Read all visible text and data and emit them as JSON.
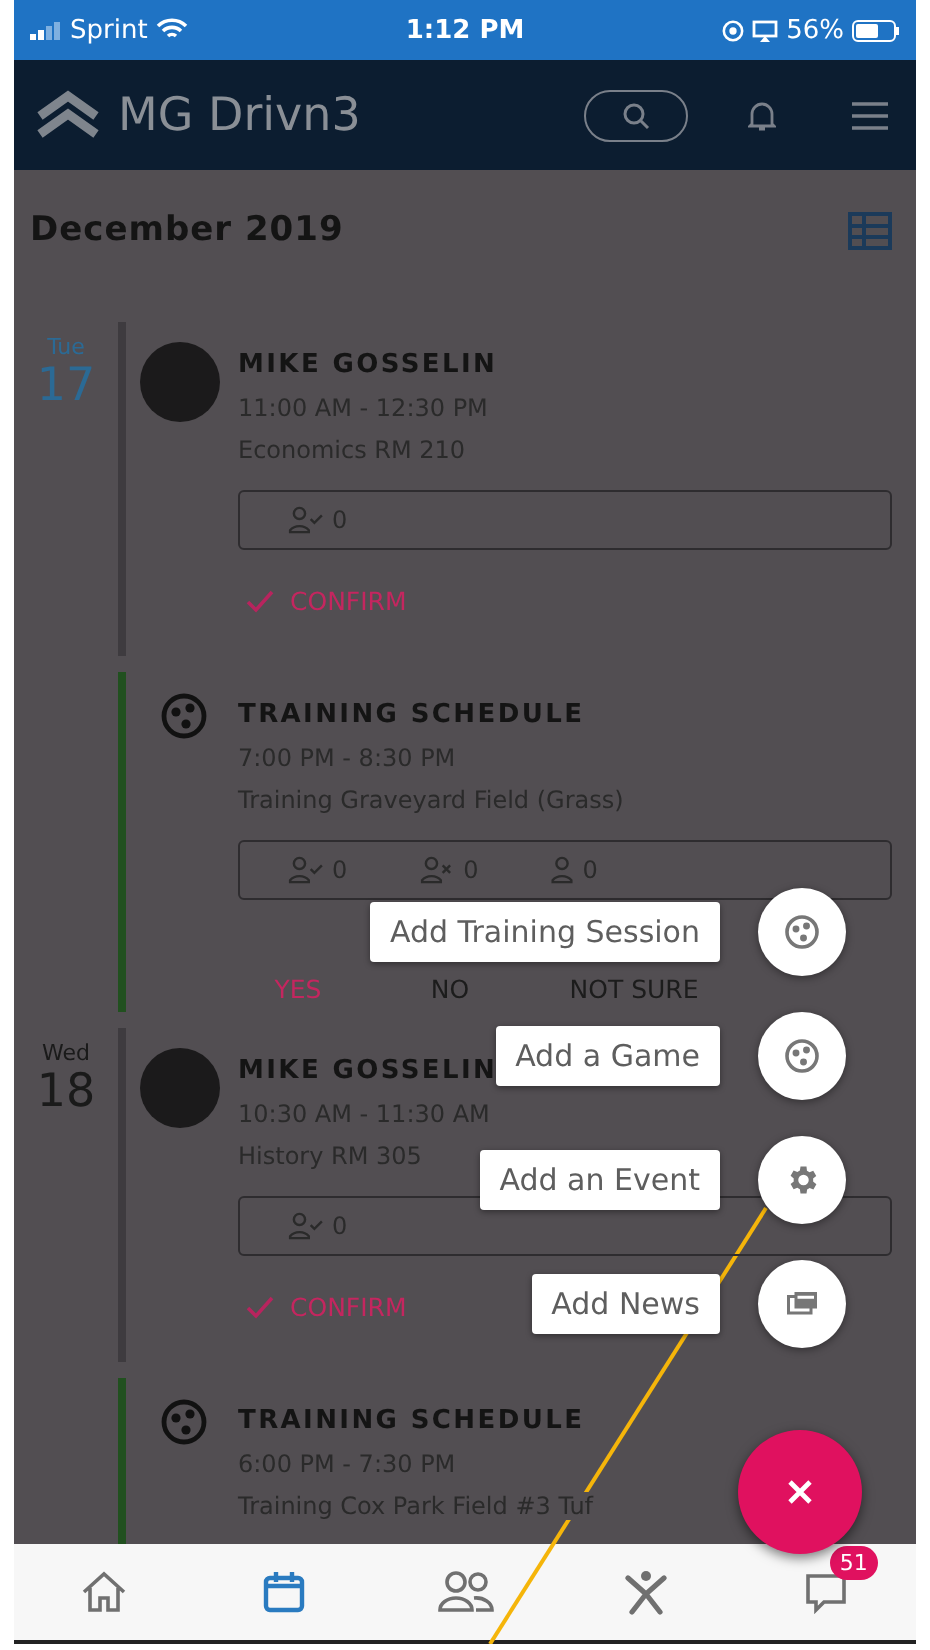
{
  "status_bar": {
    "carrier": "Sprint",
    "time": "1:12 PM",
    "battery": "56%"
  },
  "header": {
    "title": "MG Drivn3"
  },
  "month": "December 2019",
  "days": [
    {
      "weekday": "Tue",
      "date": "17",
      "today": true,
      "events": [
        {
          "kind": "lecture",
          "title": "MIKE GOSSELIN",
          "time": "11:00 AM - 12:30 PM",
          "location": "Economics RM 210",
          "attendance": [
            {
              "kind": "going",
              "count": "0"
            }
          ],
          "confirm": "CONFIRM"
        },
        {
          "kind": "training",
          "title": "TRAINING SCHEDULE",
          "time": "7:00 PM - 8:30 PM",
          "location": "Training Graveyard Field (Grass)",
          "attendance": [
            {
              "kind": "going",
              "count": "0"
            },
            {
              "kind": "not_going",
              "count": "0"
            },
            {
              "kind": "maybe",
              "count": "0"
            }
          ],
          "responses": [
            {
              "label": "YES",
              "selected": true
            },
            {
              "label": "NO",
              "selected": false
            },
            {
              "label": "NOT SURE",
              "selected": false
            }
          ]
        }
      ]
    },
    {
      "weekday": "Wed",
      "date": "18",
      "today": false,
      "events": [
        {
          "kind": "lecture",
          "title": "MIKE GOSSELIN",
          "time": "10:30 AM - 11:30 AM",
          "location": "History RM 305",
          "attendance": [
            {
              "kind": "going",
              "count": "0"
            }
          ],
          "confirm": "CONFIRM"
        },
        {
          "kind": "training",
          "title": "TRAINING SCHEDULE",
          "time": "6:00 PM - 7:30 PM",
          "location": "Training Cox Park Field #3 Tuf"
        }
      ]
    }
  ],
  "fab_menu": [
    {
      "label": "Add Training Session",
      "kind": "ball"
    },
    {
      "label": "Add a Game",
      "kind": "ball"
    },
    {
      "label": "Add an Event",
      "kind": "gear"
    },
    {
      "label": "Add News",
      "kind": "news"
    }
  ],
  "bottom_nav": [
    {
      "kind": "home",
      "selected": false
    },
    {
      "kind": "calendar",
      "selected": true
    },
    {
      "kind": "people",
      "selected": false
    },
    {
      "kind": "person",
      "selected": false
    },
    {
      "kind": "chat",
      "selected": false,
      "badge": "51"
    }
  ]
}
